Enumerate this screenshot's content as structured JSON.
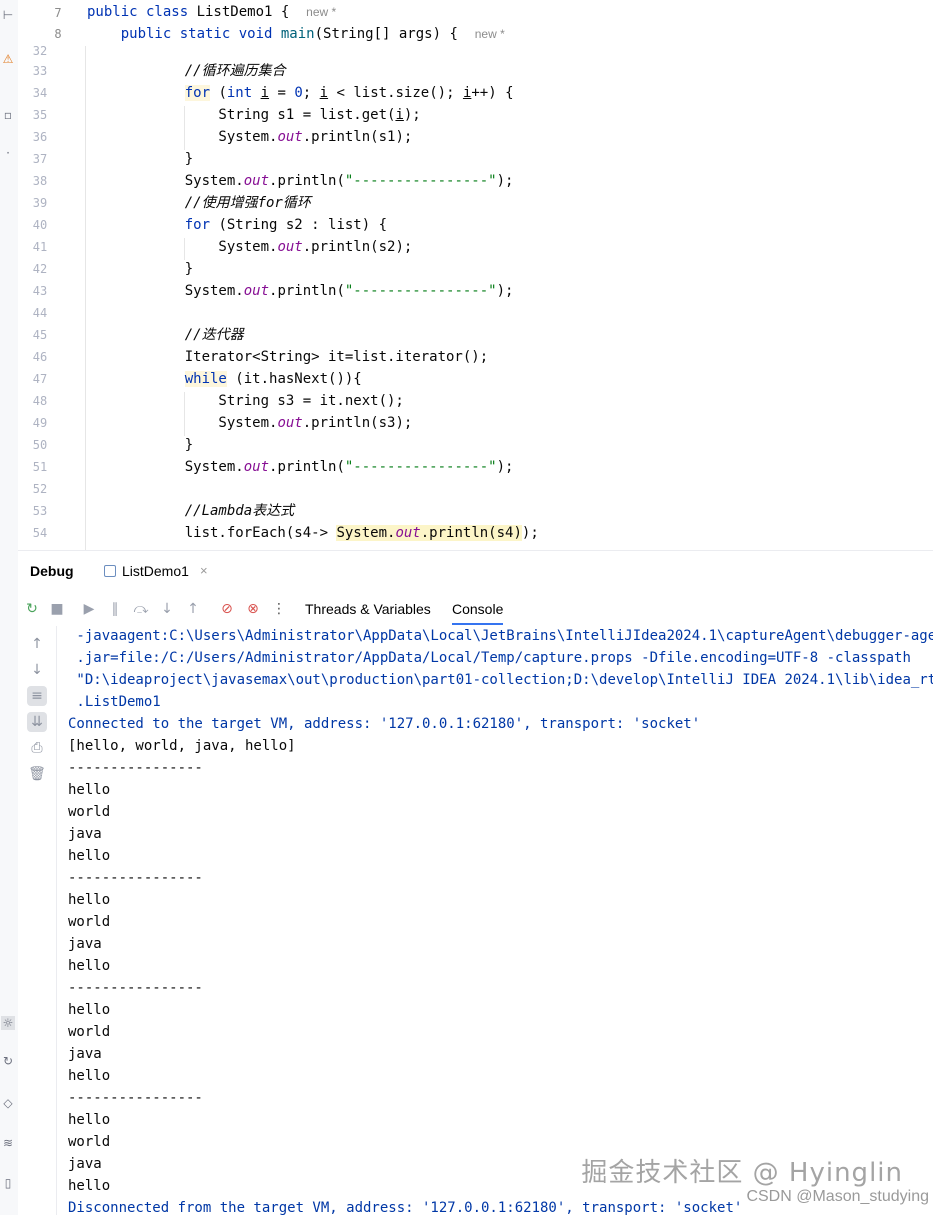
{
  "sticky": {
    "lines": [
      {
        "num": "7",
        "text": "public class ListDemo1 {",
        "hint": "new *"
      },
      {
        "num": "8",
        "text": "    public static void main(String[] args) {",
        "hint": "new *"
      }
    ]
  },
  "editor": {
    "lines": [
      {
        "num": "32",
        "code": ""
      },
      {
        "num": "33",
        "code": "    //循环遍历集合"
      },
      {
        "num": "34",
        "code": "    for (int i = 0; i < list.size(); i++) {"
      },
      {
        "num": "35",
        "code": "        String s1 = list.get(i);"
      },
      {
        "num": "36",
        "code": "        System.out.println(s1);"
      },
      {
        "num": "37",
        "code": "    }"
      },
      {
        "num": "38",
        "code": "    System.out.println(\"----------------\");"
      },
      {
        "num": "39",
        "code": "    //使用增强for循环"
      },
      {
        "num": "40",
        "code": "    for (String s2 : list) {"
      },
      {
        "num": "41",
        "code": "        System.out.println(s2);"
      },
      {
        "num": "42",
        "code": "    }"
      },
      {
        "num": "43",
        "code": "    System.out.println(\"----------------\");"
      },
      {
        "num": "44",
        "code": ""
      },
      {
        "num": "45",
        "code": "    //迭代器"
      },
      {
        "num": "46",
        "code": "    Iterator<String> it=list.iterator();"
      },
      {
        "num": "47",
        "code": "    while (it.hasNext()){"
      },
      {
        "num": "48",
        "code": "        String s3 = it.next();"
      },
      {
        "num": "49",
        "code": "        System.out.println(s3);"
      },
      {
        "num": "50",
        "code": "    }"
      },
      {
        "num": "51",
        "code": "    System.out.println(\"----------------\");"
      },
      {
        "num": "52",
        "code": ""
      },
      {
        "num": "53",
        "code": "    //Lambda表达式"
      },
      {
        "num": "54",
        "code": "    list.forEach(s4-> System.out.println(s4));"
      }
    ]
  },
  "debug": {
    "title": "Debug",
    "file_tab": "ListDemo1",
    "close": "×",
    "tabs": [
      "Threads & Variables",
      "Console"
    ],
    "active_tab": "Console",
    "toolbar_icons": [
      "rerun-icon",
      "stop-icon",
      "resume-icon",
      "pause-icon",
      "step-over-icon",
      "step-into-icon",
      "step-out-icon",
      "view-breakpoints-icon",
      "mute-breakpoints-icon",
      "more-icon"
    ]
  },
  "console": {
    "lines": [
      " -javaagent:C:\\Users\\Administrator\\AppData\\Local\\JetBrains\\IntelliJIdea2024.1\\captureAgent\\debugger-agent",
      " .jar=file:/C:/Users/Administrator/AppData/Local/Temp/capture.props -Dfile.encoding=UTF-8 -classpath",
      " \"D:\\ideaproject\\javasemax\\out\\production\\part01-collection;D:\\develop\\IntelliJ IDEA 2024.1\\lib\\idea_rt.jar\"",
      " .ListDemo1",
      "Connected to the target VM, address: '127.0.0.1:62180', transport: 'socket'",
      "[hello, world, java, hello]",
      "----------------",
      "hello",
      "world",
      "java",
      "hello",
      "----------------",
      "hello",
      "world",
      "java",
      "hello",
      "----------------",
      "hello",
      "world",
      "java",
      "hello",
      "----------------",
      "hello",
      "world",
      "java",
      "hello",
      "Disconnected from the target VM, address: '127.0.0.1:62180', transport: 'socket'"
    ],
    "system_line_indexes": [
      0,
      1,
      2,
      3,
      4,
      26
    ]
  },
  "watermark": {
    "main": "掘金技术社区 @ Hyinglin",
    "sub": "CSDN @Mason_studying"
  },
  "colors": {
    "keyword": "#0033b3",
    "comment": "#8c8c8c",
    "string": "#067d17",
    "field": "#871094",
    "system_output": "#0037a6",
    "active_tab_underline": "#3574f0"
  }
}
